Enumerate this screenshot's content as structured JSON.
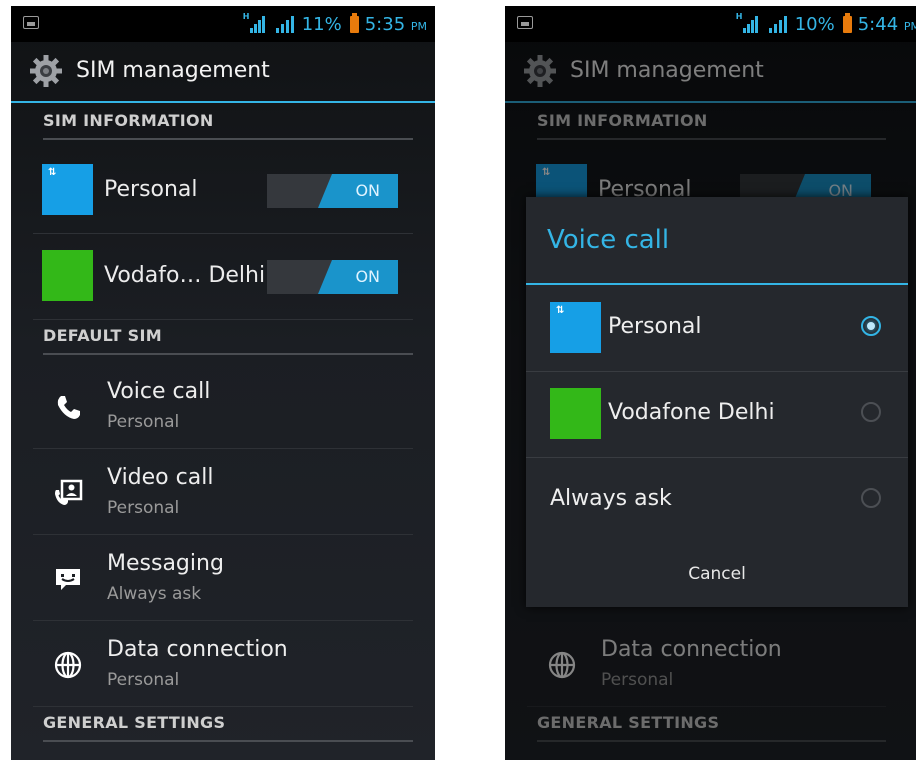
{
  "accent_color": "#34b5e5",
  "left_screen": {
    "status": {
      "battery": "11%",
      "time": "5:35",
      "ampm": "PM"
    },
    "title": "SIM management",
    "sections": {
      "sim_info": "SIM INFORMATION",
      "default_sim": "DEFAULT SIM",
      "general": "GENERAL SETTINGS"
    },
    "sims": [
      {
        "name": "Personal",
        "toggle": "ON",
        "color": "#169fe6"
      },
      {
        "name": "Vodafo… Delhi",
        "toggle": "ON",
        "color": "#33b818"
      }
    ],
    "settings": [
      {
        "title": "Voice call",
        "subtitle": "Personal",
        "icon": "phone-icon"
      },
      {
        "title": "Video call",
        "subtitle": "Personal",
        "icon": "video-call-icon"
      },
      {
        "title": "Messaging",
        "subtitle": "Always ask",
        "icon": "message-icon"
      },
      {
        "title": "Data connection",
        "subtitle": "Personal",
        "icon": "globe-icon"
      }
    ]
  },
  "right_screen": {
    "status": {
      "battery": "10%",
      "time": "5:44",
      "ampm": "PM"
    },
    "title": "SIM management",
    "sections": {
      "sim_info": "SIM INFORMATION",
      "general": "GENERAL SETTINGS"
    },
    "background_sim": {
      "name": "Personal",
      "toggle": "ON"
    },
    "background_setting": {
      "title": "Data connection",
      "subtitle": "Personal"
    },
    "dialog": {
      "title": "Voice call",
      "options": [
        {
          "label": "Personal",
          "selected": true
        },
        {
          "label": "Vodafone Delhi",
          "selected": false
        },
        {
          "label": "Always ask",
          "selected": false
        }
      ],
      "cancel": "Cancel"
    }
  }
}
